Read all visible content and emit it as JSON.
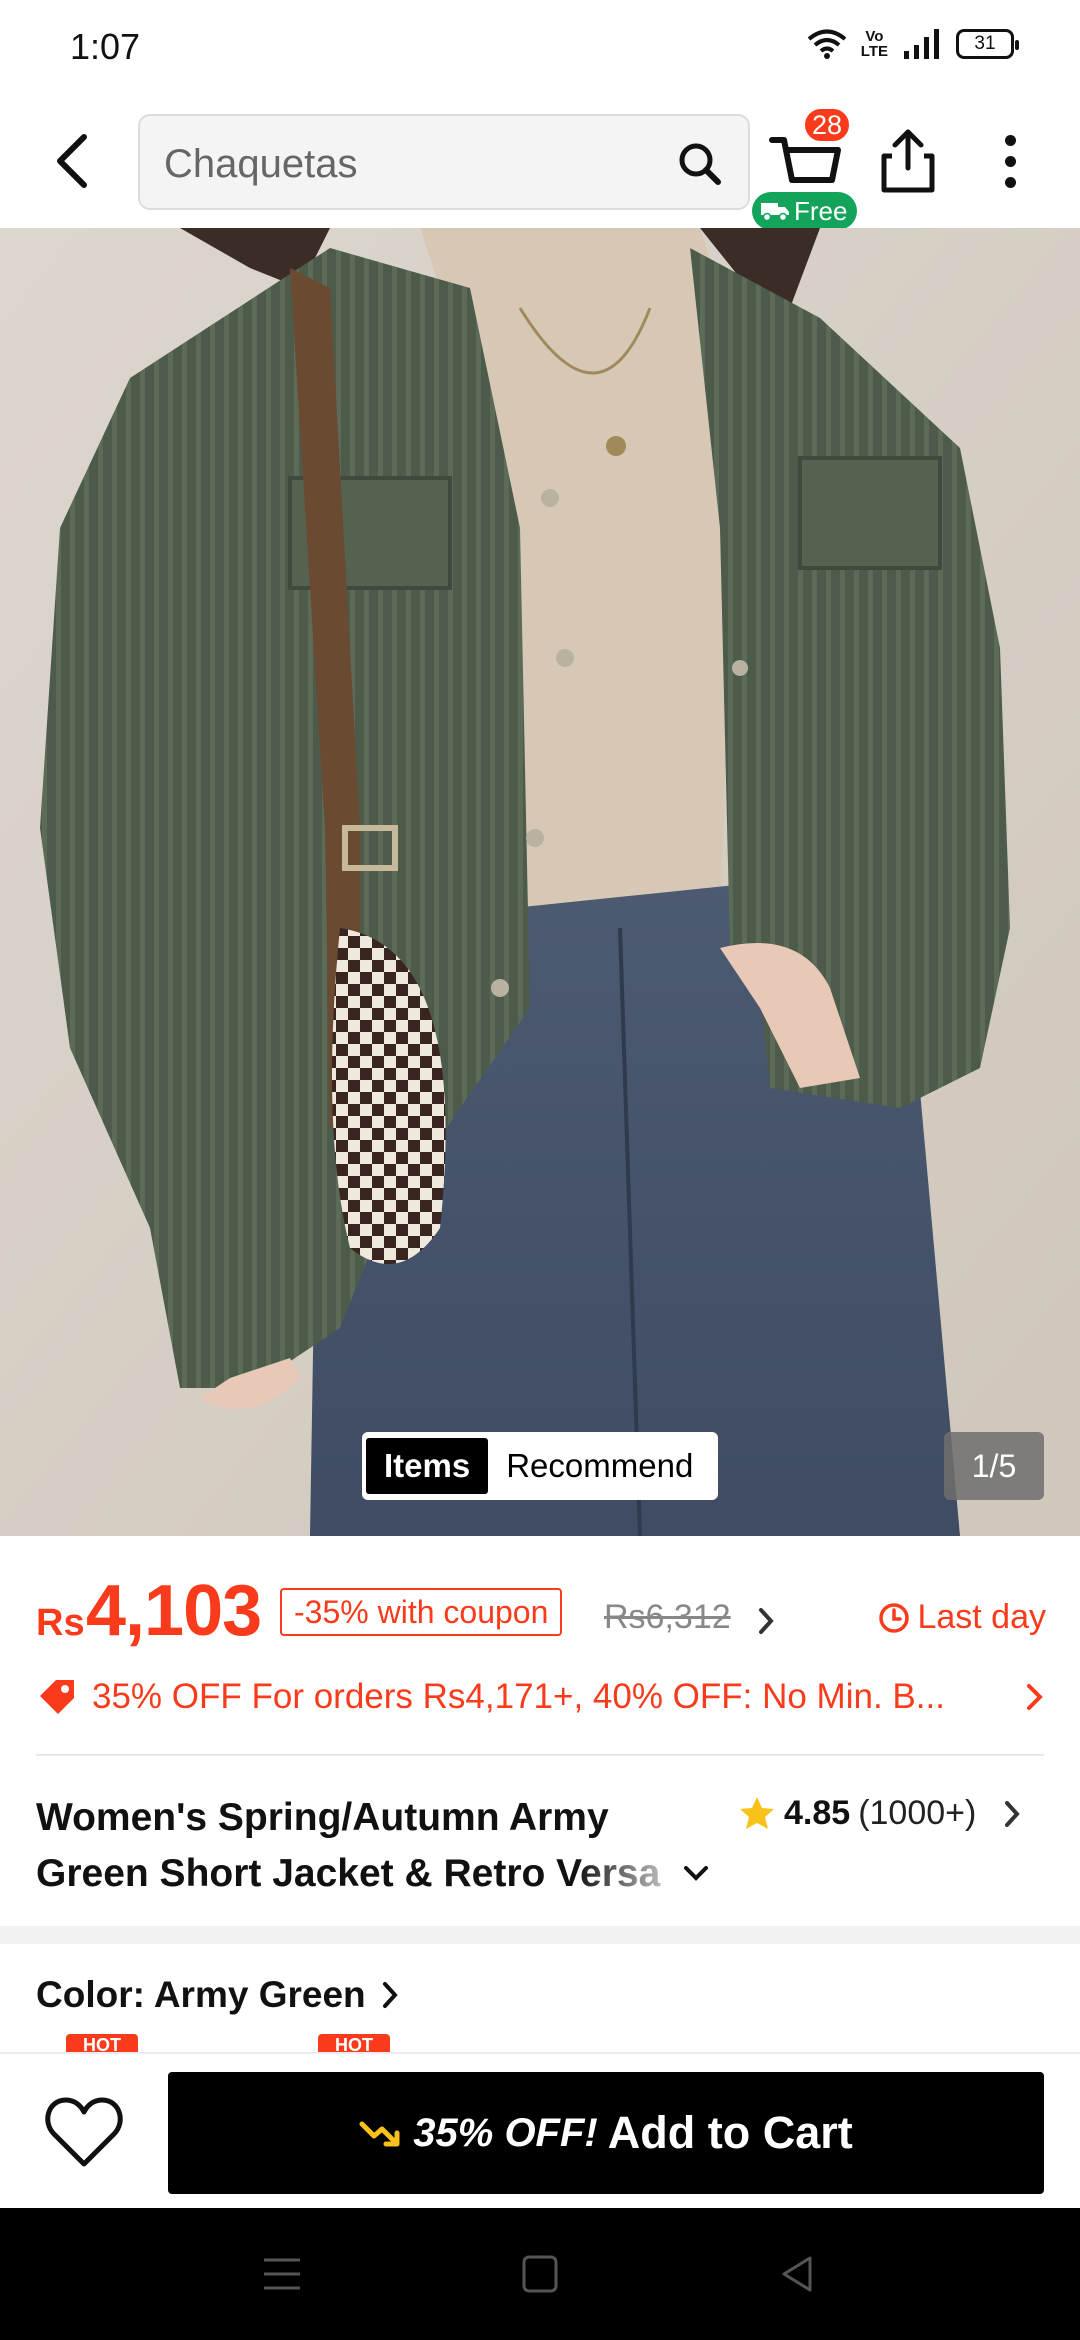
{
  "status_bar": {
    "time": "1:07",
    "volte_top": "Vo",
    "volte_bottom": "LTE",
    "battery": "31"
  },
  "header": {
    "search_placeholder": "Chaquetas",
    "cart_badge": "28",
    "free_shipping_label": "Free"
  },
  "gallery": {
    "tab_items": "Items",
    "tab_recommend": "Recommend",
    "counter": "1/5"
  },
  "price": {
    "currency": "Rs",
    "value": "4,103",
    "coupon_text": "-35% with coupon",
    "original_price": "Rs6,312",
    "deadline_text": "Last day"
  },
  "promo": {
    "text": "35% OFF For orders Rs4,171+,  40% OFF: No Min. B..."
  },
  "product": {
    "title_line1": "Women's Spring/Autumn Army",
    "title_line2": "Green Short Jacket & Retro Versa",
    "rating": "4.85",
    "review_count": "(1000+)"
  },
  "variant": {
    "color_label": "Color: Army Green",
    "hot_tag": "HOT"
  },
  "bottom_bar": {
    "discount": "35% OFF!",
    "add_to_cart": "Add to Cart"
  },
  "colors": {
    "accent": "#fa3b1b",
    "free_green": "#13a35a",
    "star": "#f8c21a",
    "cta_black": "#000000"
  }
}
